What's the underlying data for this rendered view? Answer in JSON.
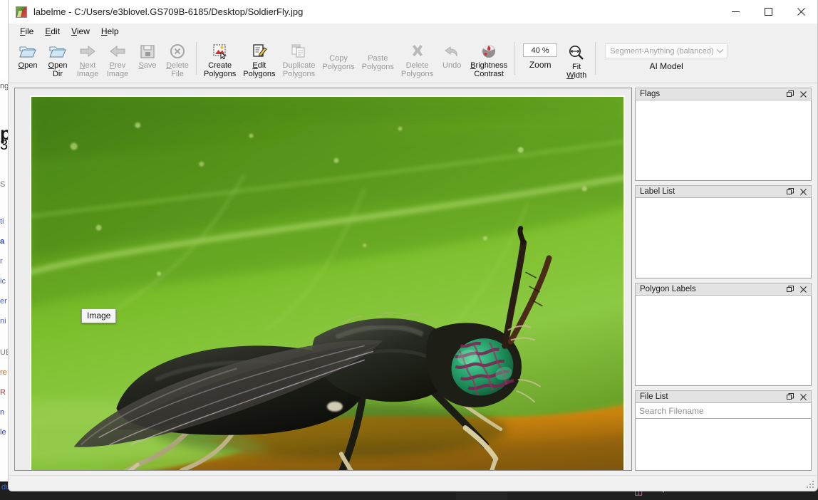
{
  "window": {
    "title": "labelme - C:/Users/e3blovel.GS709B-6185/Desktop/SoldierFly.jpg",
    "app_icon": "labelme-icon",
    "controls": {
      "minimize": "minimize-icon",
      "maximize": "maximize-icon",
      "close": "close-icon"
    }
  },
  "menu": [
    {
      "label": "File",
      "accel": "F"
    },
    {
      "label": "Edit",
      "accel": "E"
    },
    {
      "label": "View",
      "accel": "V"
    },
    {
      "label": "Help",
      "accel": "H"
    }
  ],
  "toolbar": {
    "buttons": [
      {
        "id": "open",
        "label": "Open",
        "icon": "open-folder-icon",
        "enabled": true
      },
      {
        "id": "open-dir",
        "label": "Open\nDir",
        "icon": "open-folder-icon",
        "enabled": true
      },
      {
        "id": "next-image",
        "label": "Next\nImage",
        "icon": "arrow-right-icon",
        "enabled": false
      },
      {
        "id": "prev-image",
        "label": "Prev\nImage",
        "icon": "arrow-left-icon",
        "enabled": false
      },
      {
        "id": "save",
        "label": "Save",
        "icon": "floppy-disk-icon",
        "enabled": false
      },
      {
        "id": "delete-file",
        "label": "Delete\nFile",
        "icon": "circle-x-icon",
        "enabled": false
      },
      {
        "id": "create-polygons",
        "label": "Create\nPolygons",
        "icon": "create-polygon-icon",
        "enabled": true
      },
      {
        "id": "edit-polygons",
        "label": "Edit\nPolygons",
        "icon": "edit-pencil-icon",
        "enabled": true
      },
      {
        "id": "duplicate-polygons",
        "label": "Duplicate\nPolygons",
        "icon": "duplicate-icon",
        "enabled": false
      },
      {
        "id": "copy-polygons",
        "label": "Copy\nPolygons",
        "icon": "none",
        "enabled": false
      },
      {
        "id": "paste-polygons",
        "label": "Paste\nPolygons",
        "icon": "none",
        "enabled": false
      },
      {
        "id": "delete-polygons",
        "label": "Delete\nPolygons",
        "icon": "x-cross-icon",
        "enabled": false
      },
      {
        "id": "undo",
        "label": "Undo",
        "icon": "undo-arrow-icon",
        "enabled": false
      },
      {
        "id": "brightness-contrast",
        "label": "Brightness\nContrast",
        "icon": "brightness-icon",
        "enabled": true
      }
    ],
    "zoom": {
      "value": "40 %",
      "caption": "Zoom"
    },
    "fit_width": {
      "label": "Fit\nWidth",
      "icon": "fit-width-icon"
    },
    "ai_model": {
      "selected": "Segment-Anything (balanced)",
      "caption": "AI Model",
      "chevron": "chevron-down-icon"
    }
  },
  "canvas": {
    "image_label": "Image",
    "image_alt": "soldier-fly-on-green-leaf"
  },
  "docks": [
    {
      "id": "flags",
      "title": "Flags",
      "float_icon": "float-icon",
      "close_icon": "close-icon",
      "items": []
    },
    {
      "id": "label-list",
      "title": "Label List",
      "float_icon": "float-icon",
      "close_icon": "close-icon",
      "items": []
    },
    {
      "id": "polygon-labels",
      "title": "Polygon Labels",
      "float_icon": "float-icon",
      "close_icon": "close-icon",
      "items": []
    },
    {
      "id": "file-list",
      "title": "File List",
      "float_icon": "float-icon",
      "close_icon": "close-icon",
      "search_placeholder": "Search Filename",
      "items": []
    }
  ],
  "colors": {
    "window_bg": "#f0f0f0",
    "dock_title_bg": "#e3e3e3",
    "canvas_bg": "#ededed",
    "accent_close": "#e81123",
    "disabled_text": "#9a9a9a",
    "backdrop_dark": "#1e1e1e"
  }
}
